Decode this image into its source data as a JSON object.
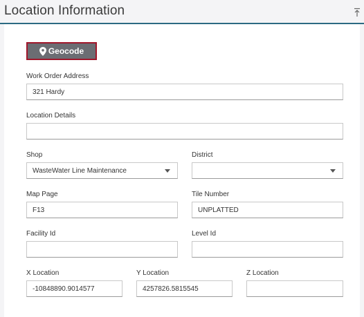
{
  "header": {
    "title": "Location Information",
    "collapse_icon": "collapse-up-icon"
  },
  "geocode": {
    "label": "Geocode",
    "icon": "map-pin-icon"
  },
  "colors": {
    "accent": "#2b6a82",
    "button_bg": "#6b6d73",
    "button_border": "#a0162a"
  },
  "fields": {
    "work_order_address": {
      "label": "Work Order Address",
      "value": "321 Hardy"
    },
    "location_details": {
      "label": "Location Details",
      "value": ""
    },
    "shop": {
      "label": "Shop",
      "value": "WasteWater Line Maintenance"
    },
    "district": {
      "label": "District",
      "value": ""
    },
    "map_page": {
      "label": "Map Page",
      "value": "F13"
    },
    "tile_number": {
      "label": "Tile Number",
      "value": "UNPLATTED"
    },
    "facility_id": {
      "label": "Facility Id",
      "value": ""
    },
    "level_id": {
      "label": "Level Id",
      "value": ""
    },
    "x_location": {
      "label": "X Location",
      "value": "-10848890.9014577"
    },
    "y_location": {
      "label": "Y Location",
      "value": "4257826.5815545"
    },
    "z_location": {
      "label": "Z Location",
      "value": ""
    }
  }
}
